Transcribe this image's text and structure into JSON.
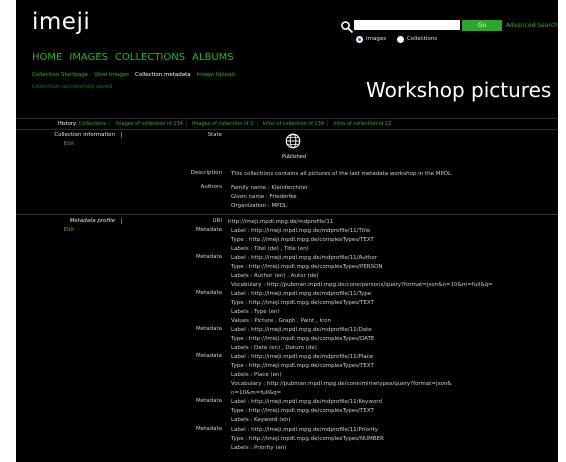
{
  "header": {
    "logo": "imeji",
    "search": {
      "go_label": "Go",
      "advanced_label": "Advanced Search",
      "opt_images": "Images",
      "opt_collections": "Collections"
    }
  },
  "nav": {
    "home": "HOME",
    "images": "IMAGES",
    "collections": "COLLECTIONS",
    "albums": "ALBUMS"
  },
  "subnav": {
    "startpage": "Collection Startpage",
    "view_images": "View Images",
    "metadata": "Collection metadata",
    "upload": "Image Upload"
  },
  "message": "Collection successfully saved",
  "page_title": "Workshop pictures",
  "history": {
    "label": "History:",
    "items": [
      "Collections",
      "Images of collection id 134",
      "Images of collection id 2",
      "Infos of collection id 134",
      "Infos of collection id 12"
    ]
  },
  "collection_info": {
    "label": "Collection information",
    "edit": "Edit",
    "state_label": "State",
    "state_value": "Published",
    "description_label": "Description",
    "description": "This collections contains all pictures of the last metadata workshop in the MPDL.",
    "authors_label": "Authors",
    "authors": [
      "Family name : Kleinferchner",
      "Given name : Friederike",
      "Organization : MPDL"
    ]
  },
  "profile": {
    "label": "Metadata profile",
    "edit": "Edit",
    "uri_label": "URI",
    "uri": "http://imeji.mpdl.mpg.de/mdprofile/11",
    "metadata_label": "Metadata",
    "metadata": [
      [
        "Label : http://imeji.mpdl.mpg.de/mdprofile/11/Title",
        "Type : http://imeji.mpdl.mpg.de/complexTypes/TEXT",
        "Labels : Titel (de) , Title (en)"
      ],
      [
        "Label : http://imeji.mpdl.mpg.de/mdprofile/11/Author",
        "Type : http://imeji.mpdl.mpg.de/complexTypes/PERSON",
        "Labels : Author (en) , Autor (de)",
        "Vocabulary : http://pubman.mpdl.mpg.de/cone/persons/query?format=json&n=10&m=full&q="
      ],
      [
        "Label : http://imeji.mpdl.mpg.de/mdprofile/11/Type",
        "Type : http://imeji.mpdl.mpg.de/complexTypes/TEXT",
        "Labels : Type (en)",
        "Values : Picture , Graph , Paint , Icon"
      ],
      [
        "Label : http://imeji.mpdl.mpg.de/mdprofile/11/Date",
        "Type : http://imeji.mpdl.mpg.de/complexTypes/DATE",
        "Labels : Date (en) , Datum (de)"
      ],
      [
        "Label : http://imeji.mpdl.mpg.de/mdprofile/11/Place",
        "Type : http://imeji.mpdl.mpg.de/complexTypes/TEXT",
        "Labels : Place (en)",
        "Vocabulary : http://pubman.mpdl.mpg.de/cone/mimetypes/query?format=json&",
        "n=10&m=full&q="
      ],
      [
        "Label : http://imeji.mpdl.mpg.de/mdprofile/11/Keyword",
        "Type : http://imeji.mpdl.mpg.de/complexTypes/TEXT",
        "Labels : Keyword (en)"
      ],
      [
        "Label : http://imeji.mpdl.mpg.de/mdprofile/11/Priority",
        "Type : http://imeji.mpdl.mpg.de/complexTypes/NUMBER",
        "Labels : Priority (en)"
      ]
    ]
  },
  "colors": {
    "background": "#000000",
    "link": "#2fb02f",
    "go_button": "#2aa82a"
  },
  "icons": [
    "search-icon",
    "globe-icon"
  ]
}
